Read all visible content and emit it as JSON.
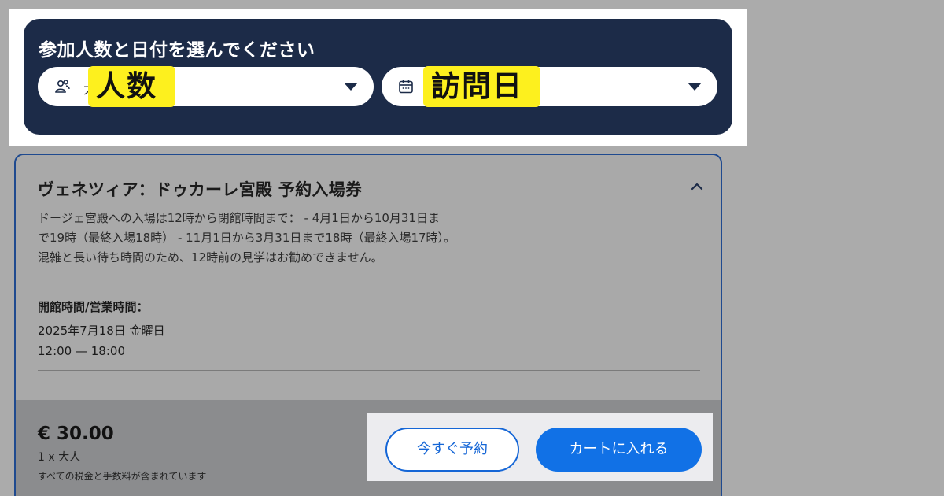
{
  "filter": {
    "title": "参加人数と日付を選んでください",
    "people": {
      "placeholder": "大",
      "icon": "people-icon",
      "highlight_label": "人数"
    },
    "date": {
      "icon": "calendar-icon",
      "highlight_label": "訪問日"
    }
  },
  "card": {
    "title": "ヴェネツィア：ドゥカーレ宮殿 予約入場券",
    "desc_lines": [
      "ドージェ宮殿への入場は12時から閉館時間まで： - 4月1日から10月31日ま",
      "で19時（最終入場18時） - 11月1日から3月31日まで18時（最終入場17時）。",
      "混雑と長い待ち時間のため、12時前の見学はお勧めできません。"
    ],
    "hours_label": "開館時間/営業時間：",
    "hours_date": "2025年7月18日 金曜日",
    "hours_time": "12:00 — 18:00",
    "price": "€ 30.00",
    "qty": "1 x 大人",
    "tax_note": "すべての税金と手数料が含まれています",
    "book_now_label": "今すぐ予約",
    "add_to_cart_label": "カートに入れる"
  },
  "colors": {
    "panel": "#1c2b48",
    "highlight": "#fdf01e",
    "primary_button": "#1171e6",
    "card_border": "#1f4a8f"
  }
}
